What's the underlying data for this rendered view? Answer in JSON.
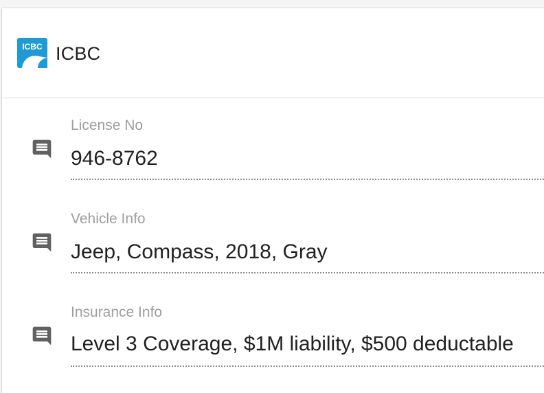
{
  "header": {
    "brand": "ICBC",
    "logo_text": "ICBC",
    "logo_color": "#1e9bd7",
    "logo_icon": "icbc-logo"
  },
  "fields": [
    {
      "label": "License No",
      "value": "946-8762",
      "icon": "comment-icon"
    },
    {
      "label": "Vehicle Info",
      "value": "Jeep, Compass, 2018, Gray",
      "icon": "comment-icon"
    },
    {
      "label": "Insurance Info",
      "value": "Level 3 Coverage, $1M liability, $500 deductable",
      "icon": "comment-icon"
    }
  ],
  "colors": {
    "label": "#9e9e9e",
    "value": "#212121",
    "icon": "#616161",
    "underline": "#8a8a8a"
  }
}
